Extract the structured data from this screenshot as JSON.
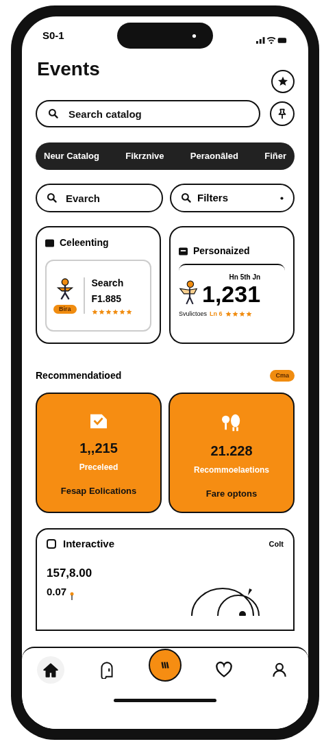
{
  "status_bar": {
    "time": "S0-1"
  },
  "header": {
    "title": "Events"
  },
  "search": {
    "placeholder": "Search catalog"
  },
  "chips": [
    "Neur Catalog",
    "Fikrznive",
    "Peraonâled",
    "Fiñer"
  ],
  "filter_row": {
    "search_placeholder": "Evarch",
    "filter_label": "Filters"
  },
  "cards": [
    {
      "title": "Celeenting",
      "label": "Search",
      "value": "F1.885",
      "badge": "Bira",
      "stars": 6
    },
    {
      "title": "Personaized",
      "caption": "Hn 5th Jn",
      "value": "1,231",
      "label": "Svulictoes",
      "note": "Ln 6",
      "stars": 4
    }
  ],
  "recommendations": {
    "title": "Recommendatioed",
    "badge": "Cma",
    "tiles": [
      {
        "value": "1,,215",
        "label": "Preceleed",
        "caption": "Fesap Eolications"
      },
      {
        "value": "21.228",
        "label": "Recommoelaetions",
        "caption": "Fare optons"
      }
    ]
  },
  "interactive": {
    "title": "Interactive",
    "action": "Colt",
    "value": "157,8.00",
    "sub": "0.07"
  },
  "nav": [
    {
      "kind": "home",
      "selected": true
    },
    {
      "kind": "chat",
      "selected": false
    },
    {
      "kind": "center",
      "selected": false
    },
    {
      "kind": "heart",
      "selected": false
    },
    {
      "kind": "profile",
      "selected": false
    }
  ]
}
